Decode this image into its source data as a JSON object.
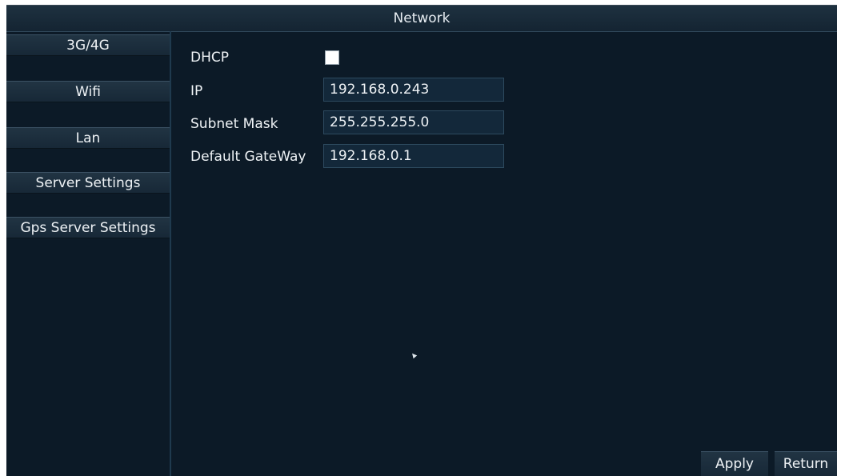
{
  "window": {
    "title": "Network"
  },
  "sidebar": {
    "items": [
      {
        "label": "3G/4G"
      },
      {
        "label": "Wifi"
      },
      {
        "label": "Lan"
      },
      {
        "label": "Server Settings"
      },
      {
        "label": "Gps Server Settings"
      }
    ]
  },
  "form": {
    "dhcp": {
      "label": "DHCP",
      "checked": false
    },
    "ip": {
      "label": "IP",
      "value": "192.168.0.243"
    },
    "subnet": {
      "label": "Subnet Mask",
      "value": "255.255.255.0"
    },
    "gateway": {
      "label": "Default GateWay",
      "value": "192.168.0.1"
    }
  },
  "actions": {
    "apply_label": "Apply",
    "return_label": "Return"
  },
  "colors": {
    "background": "#0c1a27",
    "button": "#1b2e3d",
    "field": "#13283a",
    "text": "#eef2f5"
  }
}
